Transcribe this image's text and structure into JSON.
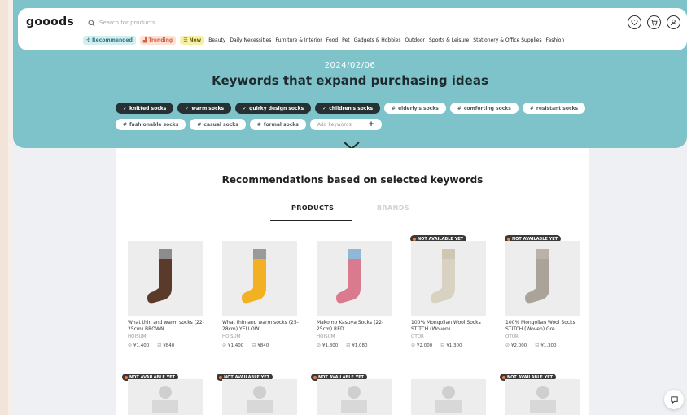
{
  "header": {
    "logo": "gooods",
    "search_placeholder": "Search for products",
    "categories": {
      "recommended": "Recommended",
      "trending": "Trending",
      "new": "New",
      "items": [
        "Beauty",
        "Daily Necessities",
        "Furniture & Interior",
        "Food",
        "Pet",
        "Gadgets & Hobbies",
        "Outdoor",
        "Sports & Leisure",
        "Stationery & Office Supplies",
        "Fashion"
      ]
    }
  },
  "hero": {
    "date": "2024/02/06",
    "title": "Keywords that expand purchasing ideas",
    "keywords_row1": [
      {
        "label": "knitted socks",
        "selected": true
      },
      {
        "label": "warm socks",
        "selected": true
      },
      {
        "label": "quirky design socks",
        "selected": true
      },
      {
        "label": "children's socks",
        "selected": true
      },
      {
        "label": "elderly's socks",
        "selected": false
      },
      {
        "label": "comforting socks",
        "selected": false
      },
      {
        "label": "resistant socks",
        "selected": false
      }
    ],
    "keywords_row2": [
      {
        "label": "fashionable socks",
        "selected": false
      },
      {
        "label": "casual socks",
        "selected": false
      },
      {
        "label": "formal socks",
        "selected": false
      }
    ],
    "add_keyword_placeholder": "Add keywords",
    "add_symbol": "+"
  },
  "recommendations": {
    "title": "Recommendations based on selected keywords",
    "tabs": [
      "PRODUCTS",
      "BRANDS"
    ],
    "not_available": "NOT AVAILABLE YET",
    "products": [
      {
        "name": "What thin and warm socks (22-25cm) BROWN",
        "brand": "HOISUM",
        "price1": "¥1,400",
        "price2": "¥840",
        "badge": false,
        "color": "#5a3a2a",
        "cuff": "#8c8c8c"
      },
      {
        "name": "What thin and warm socks (25-28cm) YELLOW",
        "brand": "HOISUM",
        "price1": "¥1,400",
        "price2": "¥840",
        "badge": false,
        "color": "#f2b023",
        "cuff": "#9a9a9a"
      },
      {
        "name": "Makomo Kasuya Socks (22-25cm) RED",
        "brand": "HOISUM",
        "price1": "¥1,800",
        "price2": "¥1,080",
        "badge": false,
        "color": "#d97a8e",
        "cuff": "#8fb7d8"
      },
      {
        "name": "100% Mongolian Wool Socks STITCH (Woven)...",
        "brand": "OTOR",
        "price1": "¥2,000",
        "price2": "¥1,300",
        "badge": true,
        "color": "#d8d2c2",
        "cuff": "#cfc7b4"
      },
      {
        "name": "100% Mongolian Wool Socks STITCH (Woven) Gre...",
        "brand": "OTOR",
        "price1": "¥2,000",
        "price2": "¥1,300",
        "badge": true,
        "color": "#a9a39a",
        "cuff": "#b9b2a6"
      }
    ],
    "row2_badges": [
      true,
      true,
      true,
      false,
      true
    ]
  },
  "colors": {
    "hero_bg": "#7ec3c9",
    "selected_chip": "#273033",
    "badge_dot": "#f07a4a"
  }
}
